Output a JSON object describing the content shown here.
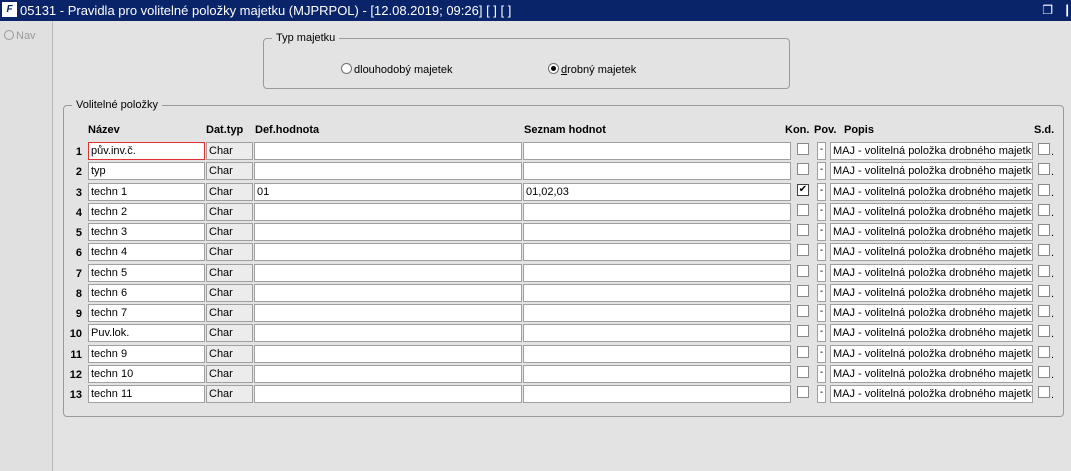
{
  "window": {
    "title": "05131 - Pravidla pro volitelné položky majetku (MJPRPOL) - [12.08.2019; 09:26]  [ ]  [ ]",
    "app_icon": "F"
  },
  "left_panel": {
    "nav_label": "Nav"
  },
  "typ_majetku": {
    "legend": "Typ majetku",
    "options": [
      {
        "label_prefix": "d",
        "label_rest": "louhodobý majetek",
        "selected": false
      },
      {
        "label_prefix": "d",
        "label_rest": "robný majetek",
        "selected": true
      }
    ]
  },
  "volitelne": {
    "legend": "Volitelné položky",
    "headers": {
      "nazev": "Název",
      "dattyp": "Dat.typ",
      "defhodnota": "Def.hodnota",
      "seznam": "Seznam hodnot",
      "kon": "Kon.",
      "pov": "Pov.",
      "popis": "Popis",
      "sd": "S.d."
    },
    "rows": [
      {
        "num": "1",
        "nazev": "pův.inv.č.",
        "dattyp": "Char",
        "def": "",
        "seznam": "",
        "kon": false,
        "pov": "-",
        "popis": "MAJ - volitelná položka drobného majetku",
        "sd": false
      },
      {
        "num": "2",
        "nazev": "typ",
        "dattyp": "Char",
        "def": "",
        "seznam": "",
        "kon": false,
        "pov": "-",
        "popis": "MAJ - volitelná položka drobného majetku",
        "sd": false
      },
      {
        "num": "3",
        "nazev": "techn 1",
        "dattyp": "Char",
        "def": "01",
        "seznam": "01,02,03",
        "kon": true,
        "pov": "-",
        "popis": "MAJ - volitelná položka drobného majetku",
        "sd": false
      },
      {
        "num": "4",
        "nazev": "techn 2",
        "dattyp": "Char",
        "def": "",
        "seznam": "",
        "kon": false,
        "pov": "-",
        "popis": "MAJ - volitelná položka drobného majetku",
        "sd": false
      },
      {
        "num": "5",
        "nazev": "techn 3",
        "dattyp": "Char",
        "def": "",
        "seznam": "",
        "kon": false,
        "pov": "-",
        "popis": "MAJ - volitelná položka drobného majetku",
        "sd": false
      },
      {
        "num": "6",
        "nazev": "techn 4",
        "dattyp": "Char",
        "def": "",
        "seznam": "",
        "kon": false,
        "pov": "-",
        "popis": "MAJ - volitelná položka drobného majetku",
        "sd": false
      },
      {
        "num": "7",
        "nazev": "techn 5",
        "dattyp": "Char",
        "def": "",
        "seznam": "",
        "kon": false,
        "pov": "-",
        "popis": "MAJ - volitelná položka drobného majetku",
        "sd": false
      },
      {
        "num": "8",
        "nazev": "techn 6",
        "dattyp": "Char",
        "def": "",
        "seznam": "",
        "kon": false,
        "pov": "-",
        "popis": "MAJ - volitelná položka drobného majetku",
        "sd": false
      },
      {
        "num": "9",
        "nazev": "techn 7",
        "dattyp": "Char",
        "def": "",
        "seznam": "",
        "kon": false,
        "pov": "-",
        "popis": "MAJ - volitelná položka drobného majetku",
        "sd": false
      },
      {
        "num": "10",
        "nazev": "Puv.lok.",
        "dattyp": "Char",
        "def": "",
        "seznam": "",
        "kon": false,
        "pov": "-",
        "popis": "MAJ - volitelná položka drobného majetku",
        "sd": false
      },
      {
        "num": "11",
        "nazev": "techn 9",
        "dattyp": "Char",
        "def": "",
        "seznam": "",
        "kon": false,
        "pov": "-",
        "popis": "MAJ - volitelná položka drobného majetku",
        "sd": false
      },
      {
        "num": "12",
        "nazev": "techn 10",
        "dattyp": "Char",
        "def": "",
        "seznam": "",
        "kon": false,
        "pov": "-",
        "popis": "MAJ - volitelná položka drobného majetku",
        "sd": false
      },
      {
        "num": "13",
        "nazev": "techn 11",
        "dattyp": "Char",
        "def": "",
        "seznam": "",
        "kon": false,
        "pov": "-",
        "popis": "MAJ - volitelná položka drobného majetku",
        "sd": false
      }
    ]
  }
}
